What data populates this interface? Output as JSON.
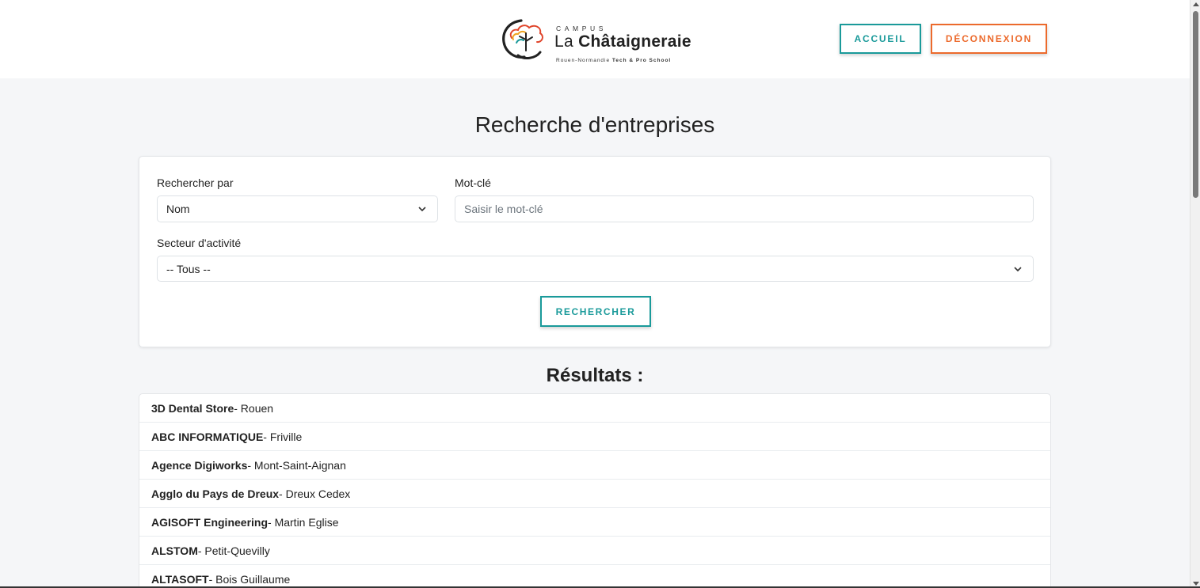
{
  "header": {
    "logo": {
      "campus": "CAMPUS",
      "name_light": "La ",
      "name_bold": "Châtaigneraie",
      "tagline_light": "Rouen-Normandie ",
      "tagline_bold": "Tech & Pro School"
    },
    "nav": {
      "accueil_label": "ACCUEIL",
      "deconnexion_label": "DÉCONNEXION"
    }
  },
  "page_title": "Recherche d'entreprises",
  "search": {
    "search_by_label": "Rechercher par",
    "search_by_value": "Nom",
    "keyword_label": "Mot-clé",
    "keyword_placeholder": "Saisir le mot-clé",
    "keyword_value": "",
    "sector_label": "Secteur d'activité",
    "sector_value": "-- Tous --",
    "submit_label": "RECHERCHER"
  },
  "results": {
    "title": "Résultats :",
    "items": [
      {
        "name": "3D Dental Store",
        "city": " - Rouen"
      },
      {
        "name": "ABC INFORMATIQUE",
        "city": " - Friville"
      },
      {
        "name": "Agence Digiworks",
        "city": " - Mont-Saint-Aignan"
      },
      {
        "name": "Agglo du Pays de Dreux",
        "city": " - Dreux Cedex"
      },
      {
        "name": "AGISOFT Engineering",
        "city": " - Martin Eglise"
      },
      {
        "name": "ALSTOM",
        "city": " - Petit-Quevilly"
      },
      {
        "name": "ALTASOFT",
        "city": " - Bois Guillaume"
      }
    ]
  },
  "colors": {
    "teal": "#1a9a9a",
    "orange": "#ec6a2c",
    "page_background": "#f5f6f8"
  }
}
